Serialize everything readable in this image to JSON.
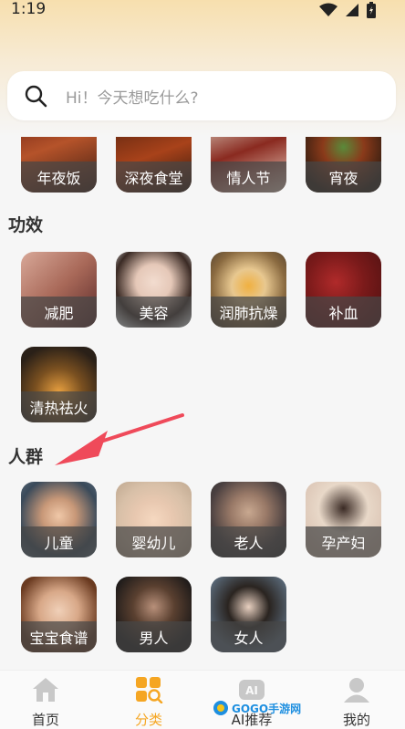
{
  "status": {
    "time": "1:19"
  },
  "search": {
    "placeholder": "Hi！今天想吃什么?"
  },
  "top_row": [
    {
      "label": "年夜饭",
      "icon": "dish-photo"
    },
    {
      "label": "深夜食堂",
      "icon": "dish-photo"
    },
    {
      "label": "情人节",
      "icon": "dish-photo"
    },
    {
      "label": "宵夜",
      "icon": "dish-photo"
    }
  ],
  "efficacy": {
    "title": "功效",
    "items": [
      {
        "label": "减肥"
      },
      {
        "label": "美容"
      },
      {
        "label": "润肺抗燥"
      },
      {
        "label": "补血"
      },
      {
        "label": "清热祛火"
      }
    ]
  },
  "crowd": {
    "title": "人群",
    "items": [
      {
        "label": "儿童"
      },
      {
        "label": "婴幼儿"
      },
      {
        "label": "老人"
      },
      {
        "label": "孕产妇"
      },
      {
        "label": "宝宝食谱"
      },
      {
        "label": "男人"
      },
      {
        "label": "女人"
      }
    ]
  },
  "tabbar": {
    "items": [
      {
        "label": "首页",
        "icon": "home-icon"
      },
      {
        "label": "分类",
        "icon": "category-icon",
        "active": true
      },
      {
        "label": "AI推荐",
        "icon": "ai-icon"
      },
      {
        "label": "我的",
        "icon": "profile-icon"
      }
    ],
    "watermark": "GOGO手游网"
  },
  "colors": {
    "accent": "#f5a623",
    "arrow": "#ef4a5a",
    "label_bg": "#555555"
  }
}
